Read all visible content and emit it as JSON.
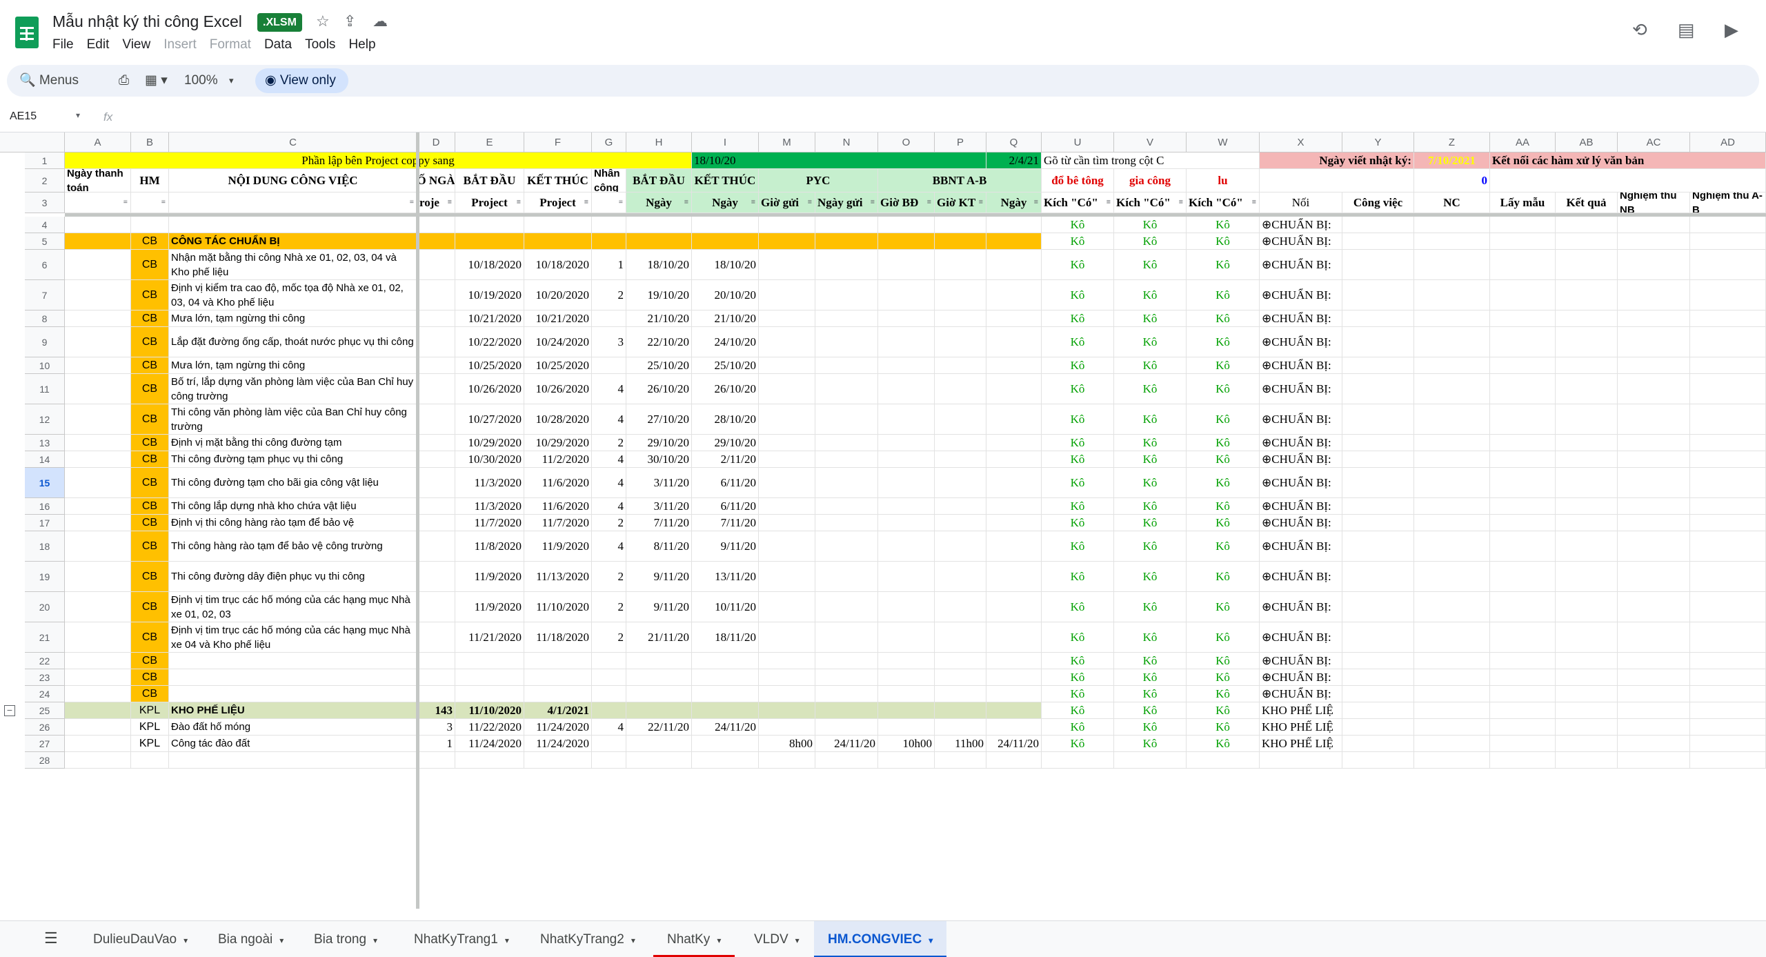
{
  "app": {
    "title": "Mẫu nhật ký thi công Excel",
    "badge": ".XLSM",
    "menus": [
      "File",
      "Edit",
      "View",
      "Insert",
      "Format",
      "Data",
      "Tools",
      "Help"
    ],
    "dim_menus": [
      "Insert",
      "Format"
    ]
  },
  "toolbar": {
    "menus_label": "Menus",
    "zoom": "100%",
    "view_only_label": "View only"
  },
  "formula": {
    "name_box": "AE15",
    "fx": "fx"
  },
  "columns": [
    "A",
    "B",
    "C",
    "D",
    "E",
    "F",
    "G",
    "H",
    "I",
    "M",
    "N",
    "O",
    "P",
    "Q",
    "U",
    "V",
    "W",
    "X",
    "Y",
    "Z",
    "AA",
    "AB",
    "AC",
    "AD"
  ],
  "header_rows": {
    "r1_yellow": "Phần lập bên Project coppy sang",
    "r1_h": "18/10/20",
    "r1_q": "2/4/21",
    "r1_u": "Gõ từ cần tìm trong cột C",
    "r1_y": "Ngày viết nhật ký:",
    "r1_z": "7/10/2021",
    "r1_aa": "Kết nối các hàm xử lý văn bản",
    "r2": [
      "Ngày thanh toán",
      "HM",
      "NỘI DUNG CÔNG VIỆC",
      "Ố NGÀ",
      "BẮT ĐẦU",
      "KẾT THÚC",
      "Nhân công",
      "BẮT ĐẦU",
      "KẾT THÚC",
      "PYC",
      "BBNT A-B",
      "đổ bê tông",
      "gia công",
      "lu",
      "0"
    ],
    "r3": [
      "Project",
      "Project",
      "Ngày",
      "Ngày",
      "Giờ gửi",
      "Ngày gửi",
      "Giờ BĐ",
      "Giờ KT",
      "Ngày",
      "Kích \"Có\"",
      "Kích \"Có\"",
      "Kích \"Có\"",
      "Nối",
      "Công việc",
      "NC",
      "Lấy mẫu",
      "Kết quả",
      "Nghiệm thu NB",
      "Nghiệm thu A-B",
      "roje"
    ]
  },
  "rows": [
    {
      "n": "4",
      "b": "",
      "c": "",
      "d": "",
      "e": "",
      "f": "",
      "g": "",
      "h": "",
      "i": "",
      "x": "⊕CHUẨN BỊ:"
    },
    {
      "n": "5",
      "b": "CB",
      "c": "CÔNG TÁC CHUẨN BỊ",
      "d": "",
      "e": "",
      "f": "",
      "g": "",
      "h": "",
      "i": "",
      "x": "⊕CHUẨN BỊ:"
    },
    {
      "n": "6",
      "b": "CB",
      "c": "Nhận mặt bằng thi công Nhà xe 01, 02, 03, 04 và Kho phế liệu",
      "d": "",
      "e": "10/18/2020",
      "f": "10/18/2020",
      "g": "1",
      "h": "18/10/20",
      "i": "18/10/20",
      "x": "⊕CHUẨN BỊ:"
    },
    {
      "n": "7",
      "b": "CB",
      "c": "Định vị kiểm tra cao độ, mốc tọa độ Nhà xe 01, 02, 03, 04 và Kho phế liệu",
      "d": "",
      "e": "10/19/2020",
      "f": "10/20/2020",
      "g": "2",
      "h": "19/10/20",
      "i": "20/10/20",
      "x": "⊕CHUẨN BỊ:"
    },
    {
      "n": "8",
      "b": "CB",
      "c": "Mưa lớn, tạm ngừng thi công",
      "d": "",
      "e": "10/21/2020",
      "f": "10/21/2020",
      "g": "",
      "h": "21/10/20",
      "i": "21/10/20",
      "x": "⊕CHUẨN BỊ:"
    },
    {
      "n": "9",
      "b": "CB",
      "c": "Lắp đặt đường ống cấp, thoát nước phục vụ thi công",
      "d": "",
      "e": "10/22/2020",
      "f": "10/24/2020",
      "g": "3",
      "h": "22/10/20",
      "i": "24/10/20",
      "x": "⊕CHUẨN BỊ:"
    },
    {
      "n": "10",
      "b": "CB",
      "c": "Mưa lớn, tạm ngừng thi công",
      "d": "",
      "e": "10/25/2020",
      "f": "10/25/2020",
      "g": "",
      "h": "25/10/20",
      "i": "25/10/20",
      "x": "⊕CHUẨN BỊ:"
    },
    {
      "n": "11",
      "b": "CB",
      "c": "Bố trí, lắp dựng văn phòng làm việc của Ban Chỉ huy công trường",
      "d": "",
      "e": "10/26/2020",
      "f": "10/26/2020",
      "g": "4",
      "h": "26/10/20",
      "i": "26/10/20",
      "x": "⊕CHUẨN BỊ:"
    },
    {
      "n": "12",
      "b": "CB",
      "c": "Thi công văn phòng làm việc của Ban Chỉ huy công trường",
      "d": "",
      "e": "10/27/2020",
      "f": "10/28/2020",
      "g": "4",
      "h": "27/10/20",
      "i": "28/10/20",
      "x": "⊕CHUẨN BỊ:"
    },
    {
      "n": "13",
      "b": "CB",
      "c": "Định vị mặt bằng thi công đường tạm",
      "d": "",
      "e": "10/29/2020",
      "f": "10/29/2020",
      "g": "2",
      "h": "29/10/20",
      "i": "29/10/20",
      "x": "⊕CHUẨN BỊ:"
    },
    {
      "n": "14",
      "b": "CB",
      "c": "Thi công đường tạm phục vụ thi công",
      "d": "",
      "e": "10/30/2020",
      "f": "11/2/2020",
      "g": "4",
      "h": "30/10/20",
      "i": "2/11/20",
      "x": "⊕CHUẨN BỊ:"
    },
    {
      "n": "15",
      "b": "CB",
      "c": "Thi công đường tạm cho bãi gia công vật liệu",
      "d": "",
      "e": "11/3/2020",
      "f": "11/6/2020",
      "g": "4",
      "h": "3/11/20",
      "i": "6/11/20",
      "x": "⊕CHUẨN BỊ:"
    },
    {
      "n": "16",
      "b": "CB",
      "c": "Thi công lắp dựng nhà kho chứa vật liệu",
      "d": "",
      "e": "11/3/2020",
      "f": "11/6/2020",
      "g": "4",
      "h": "3/11/20",
      "i": "6/11/20",
      "x": "⊕CHUẨN BỊ:"
    },
    {
      "n": "17",
      "b": "CB",
      "c": "Định vị thi công hàng rào tạm để bảo vệ",
      "d": "",
      "e": "11/7/2020",
      "f": "11/7/2020",
      "g": "2",
      "h": "7/11/20",
      "i": "7/11/20",
      "x": "⊕CHUẨN BỊ:"
    },
    {
      "n": "18",
      "b": "CB",
      "c": "Thi công hàng rào tạm để bảo vệ công trường",
      "d": "",
      "e": "11/8/2020",
      "f": "11/9/2020",
      "g": "4",
      "h": "8/11/20",
      "i": "9/11/20",
      "x": "⊕CHUẨN BỊ:"
    },
    {
      "n": "19",
      "b": "CB",
      "c": "Thi công đường dây điện phục vụ thi công",
      "d": "",
      "e": "11/9/2020",
      "f": "11/13/2020",
      "g": "2",
      "h": "9/11/20",
      "i": "13/11/20",
      "x": "⊕CHUẨN BỊ:"
    },
    {
      "n": "20",
      "b": "CB",
      "c": "Định vị tim trục các hố móng của các hạng mục Nhà xe 01, 02, 03",
      "d": "",
      "e": "11/9/2020",
      "f": "11/10/2020",
      "g": "2",
      "h": "9/11/20",
      "i": "10/11/20",
      "x": "⊕CHUẨN BỊ:"
    },
    {
      "n": "21",
      "b": "CB",
      "c": "Định vị tim trục các hố móng của các hạng mục Nhà xe 04 và Kho phế liệu",
      "d": "",
      "e": "11/21/2020",
      "f": "11/18/2020",
      "g": "2",
      "h": "21/11/20",
      "i": "18/11/20",
      "x": "⊕CHUẨN BỊ:"
    },
    {
      "n": "22",
      "b": "CB",
      "c": "",
      "d": "",
      "e": "",
      "f": "",
      "g": "",
      "h": "",
      "i": "",
      "x": "⊕CHUẨN BỊ:"
    },
    {
      "n": "23",
      "b": "CB",
      "c": "",
      "d": "",
      "e": "",
      "f": "",
      "g": "",
      "h": "",
      "i": "",
      "x": "⊕CHUẨN BỊ:"
    },
    {
      "n": "24",
      "b": "CB",
      "c": "",
      "d": "",
      "e": "",
      "f": "",
      "g": "",
      "h": "",
      "i": "",
      "x": "⊕CHUẨN BỊ:"
    },
    {
      "n": "25",
      "b": "KPL",
      "c": "KHO PHẾ LIỆU",
      "d": "143",
      "e": "11/10/2020",
      "f": "4/1/2021",
      "g": "",
      "h": "",
      "i": "",
      "x": "KHO PHẾ LIỆ"
    },
    {
      "n": "26",
      "b": "KPL",
      "c": "Đào đất hố móng",
      "d": "3",
      "e": "11/22/2020",
      "f": "11/24/2020",
      "g": "4",
      "h": "22/11/20",
      "i": "24/11/20",
      "x": "KHO PHẾ LIỆ"
    },
    {
      "n": "27",
      "b": "KPL",
      "c": "Công tác đào đất",
      "d": "1",
      "e": "11/24/2020",
      "f": "11/24/2020",
      "g": "",
      "h": "",
      "i": "",
      "x": "KHO PHẾ LIỆ",
      "m": "8h00",
      "nn": "24/11/20",
      "o": "10h00",
      "p": "11h00",
      "q": "24/11/20"
    }
  ],
  "ko_value": "Kô",
  "sheets": [
    "DulieuDauVao",
    "Bia ngoài",
    "Bia trong",
    "NhatKyTrang1",
    "NhatKyTrang2",
    "NhatKy",
    "VLDV",
    "HM.CONGVIEC"
  ],
  "active_sheet": "HM.CONGVIEC",
  "colors": {
    "yellow": "#ffff00",
    "green": "#00b050",
    "light_green": "#c6efce",
    "pink": "#f4b6b6",
    "orange": "#ffc000",
    "kpl_row": "#d8e4bc",
    "ko_green": "#00a000"
  }
}
